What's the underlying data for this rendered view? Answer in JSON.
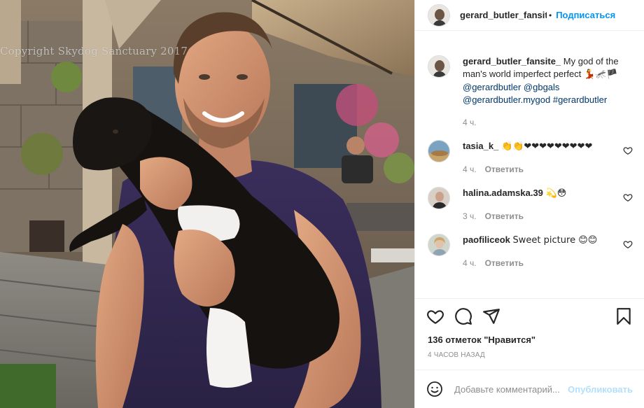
{
  "photo": {
    "watermark": "Copyright Skydog Sanctuary 2017",
    "alt": "man holding a black and white lamb"
  },
  "header": {
    "username": "gerard_butler_fansit",
    "separator": "•",
    "follow_label": "Подписаться"
  },
  "caption": {
    "username": "gerard_butler_fansite_",
    "text": "My god of the man's world imperfect perfect",
    "emojis": "💃🦟🏴",
    "tags": [
      "@gerardbutler",
      "@gbgals",
      "@gerardbutler.mygod",
      "#gerardbutler"
    ],
    "time": "4 ч."
  },
  "comments": [
    {
      "username": "tasia_k_",
      "text": "👏👏❤❤❤❤❤❤❤❤❤",
      "time": "4 ч.",
      "reply": "Ответить"
    },
    {
      "username": "halina.adamska.39",
      "text": "💫😳",
      "time": "3 ч.",
      "reply": "Ответить"
    },
    {
      "username": "paofiliceok",
      "text": "Sweet picture 😊😊",
      "time": "4 ч.",
      "reply": "Ответить"
    }
  ],
  "likes_text": "136 отметок \"Нравится\"",
  "time_ago": "4 часов назад",
  "add_comment": {
    "placeholder": "Добавьте комментарий...",
    "publish_label": "Опубликовать"
  },
  "icons": {
    "like": "heart-icon",
    "comment": "comment-icon",
    "share": "share-icon",
    "save": "bookmark-icon",
    "emoji": "smile-icon"
  },
  "colors": {
    "accent": "#0095f6",
    "link": "#00376b",
    "muted": "#8e8e8e",
    "publish_disabled": "#b2dffc"
  }
}
